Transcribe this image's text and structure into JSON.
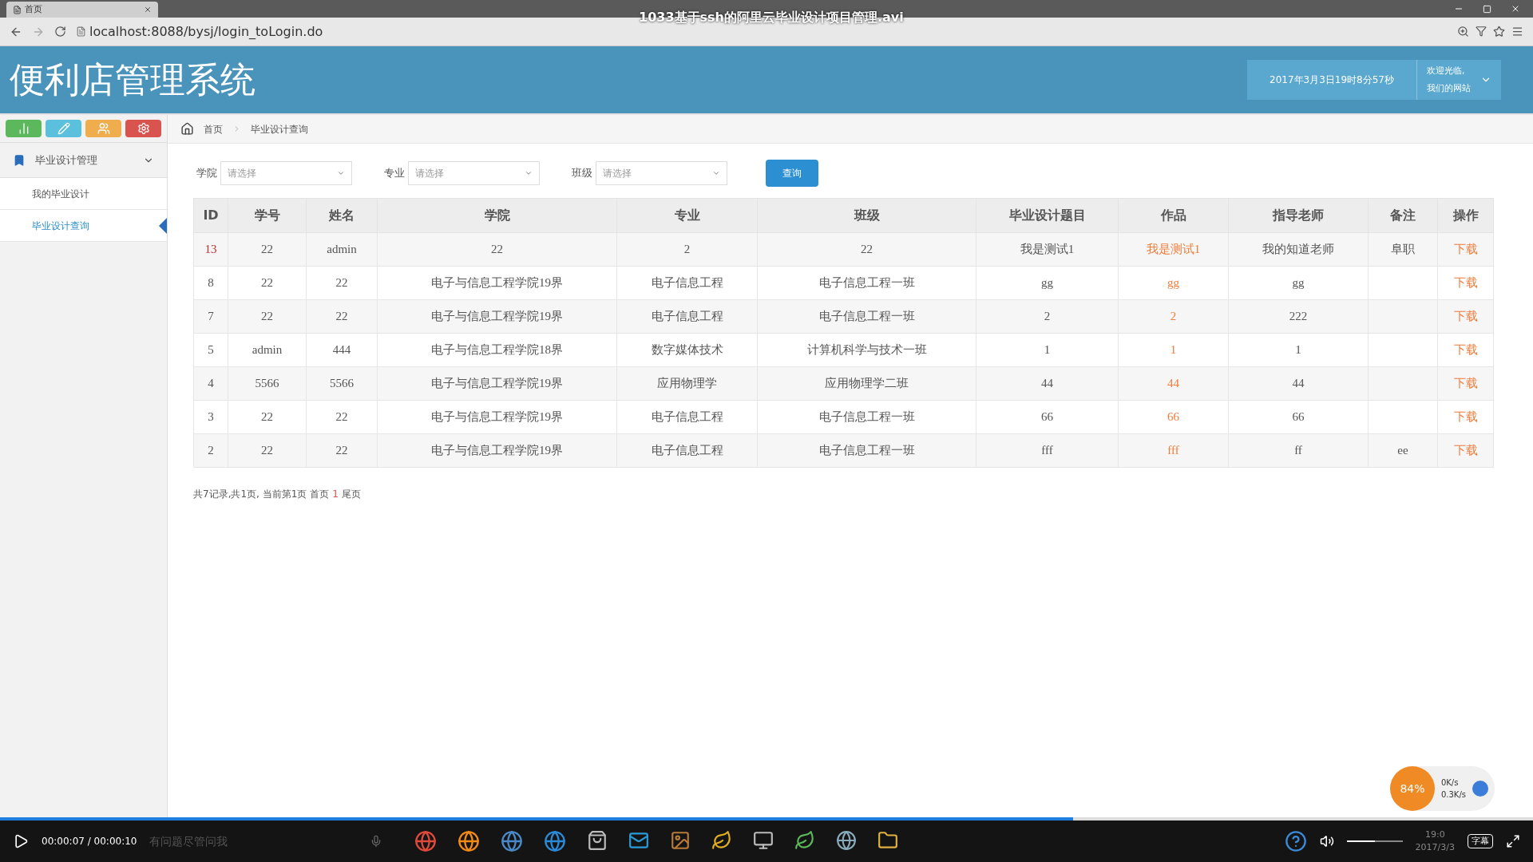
{
  "browser": {
    "tab_title": "首页",
    "url": "localhost:8088/bysj/login_toLogin.do"
  },
  "video": {
    "title": "1033基于ssh的阿里云毕业设计项目管理.avi",
    "time": "00:00:07 / 00:00:10",
    "subtitle_button": "字幕",
    "progress": {
      "level": 0.7
    },
    "volume": {
      "level": 0.5
    }
  },
  "header": {
    "title": "便利店管理系统",
    "datetime": "2017年3月3日19时8分57秒",
    "welcome": [
      "欢迎光临,",
      "我们的网站"
    ]
  },
  "shortcuts": [
    {
      "kind": "chart",
      "color": "#5cb85c"
    },
    {
      "kind": "pencil",
      "color": "#5bc0de"
    },
    {
      "kind": "users",
      "color": "#f0ad4e"
    },
    {
      "kind": "cogs",
      "color": "#d9534f"
    }
  ],
  "sidebar": {
    "items": [
      {
        "label": "毕业设计管理",
        "expanded": true,
        "children": [
          {
            "label": "我的毕业设计",
            "selected": false
          },
          {
            "label": "毕业设计查询",
            "selected": true
          }
        ]
      }
    ]
  },
  "breadcrumb": [
    "首页",
    "毕业设计查询"
  ],
  "filters": [
    {
      "label": "学院",
      "placeholder": "请选择"
    },
    {
      "label": "专业",
      "placeholder": "请选择"
    },
    {
      "label": "班级",
      "placeholder": "请选择"
    }
  ],
  "query_button": "查询",
  "table": {
    "columns": [
      "ID",
      "学号",
      "姓名",
      "学院",
      "专业",
      "班级",
      "毕业设计题目",
      "作品",
      "指导老师",
      "备注",
      "操作"
    ],
    "rows": [
      {
        "highlighted": true,
        "cells": [
          "13",
          "22",
          "admin",
          "22",
          "2",
          "22",
          "我是测试1",
          "我是测试1",
          "我的知道老师",
          "阜职",
          "下载"
        ]
      },
      {
        "highlighted": false,
        "cells": [
          "8",
          "22",
          "22",
          "电子与信息工程学院19界",
          "电子信息工程",
          "电子信息工程一班",
          "gg",
          "gg",
          "gg",
          "",
          "下载"
        ]
      },
      {
        "highlighted": false,
        "cells": [
          "7",
          "22",
          "22",
          "电子与信息工程学院19界",
          "电子信息工程",
          "电子信息工程一班",
          "2",
          "2",
          "222",
          "",
          "下载"
        ]
      },
      {
        "highlighted": false,
        "cells": [
          "5",
          "admin",
          "444",
          "电子与信息工程学院18界",
          "数字媒体技术",
          "计算机科学与技术一班",
          "1",
          "1",
          "1",
          "",
          "下载"
        ]
      },
      {
        "highlighted": false,
        "cells": [
          "4",
          "5566",
          "5566",
          "电子与信息工程学院19界",
          "应用物理学",
          "应用物理学二班",
          "44",
          "44",
          "44",
          "",
          "下载"
        ]
      },
      {
        "highlighted": false,
        "cells": [
          "3",
          "22",
          "22",
          "电子与信息工程学院19界",
          "电子信息工程",
          "电子信息工程一班",
          "66",
          "66",
          "66",
          "",
          "下载"
        ]
      },
      {
        "highlighted": false,
        "cells": [
          "2",
          "22",
          "22",
          "电子与信息工程学院19界",
          "电子信息工程",
          "电子信息工程一班",
          "fff",
          "fff",
          "ff",
          "ee",
          "下载"
        ]
      }
    ]
  },
  "pagination": {
    "summary": "共7记录,共1页, 当前第1页",
    "links": [
      {
        "label": "首页",
        "selected": false
      },
      {
        "label": "1",
        "selected": true
      },
      {
        "label": "尾页",
        "selected": false
      }
    ]
  },
  "tray": {
    "speed_badge": "84%",
    "net": [
      "0K/s",
      "0.3K/s"
    ]
  },
  "taskbar": {
    "search_placeholder": "有问题尽管问我",
    "clock": "19:0",
    "date": "2017/3/3"
  }
}
